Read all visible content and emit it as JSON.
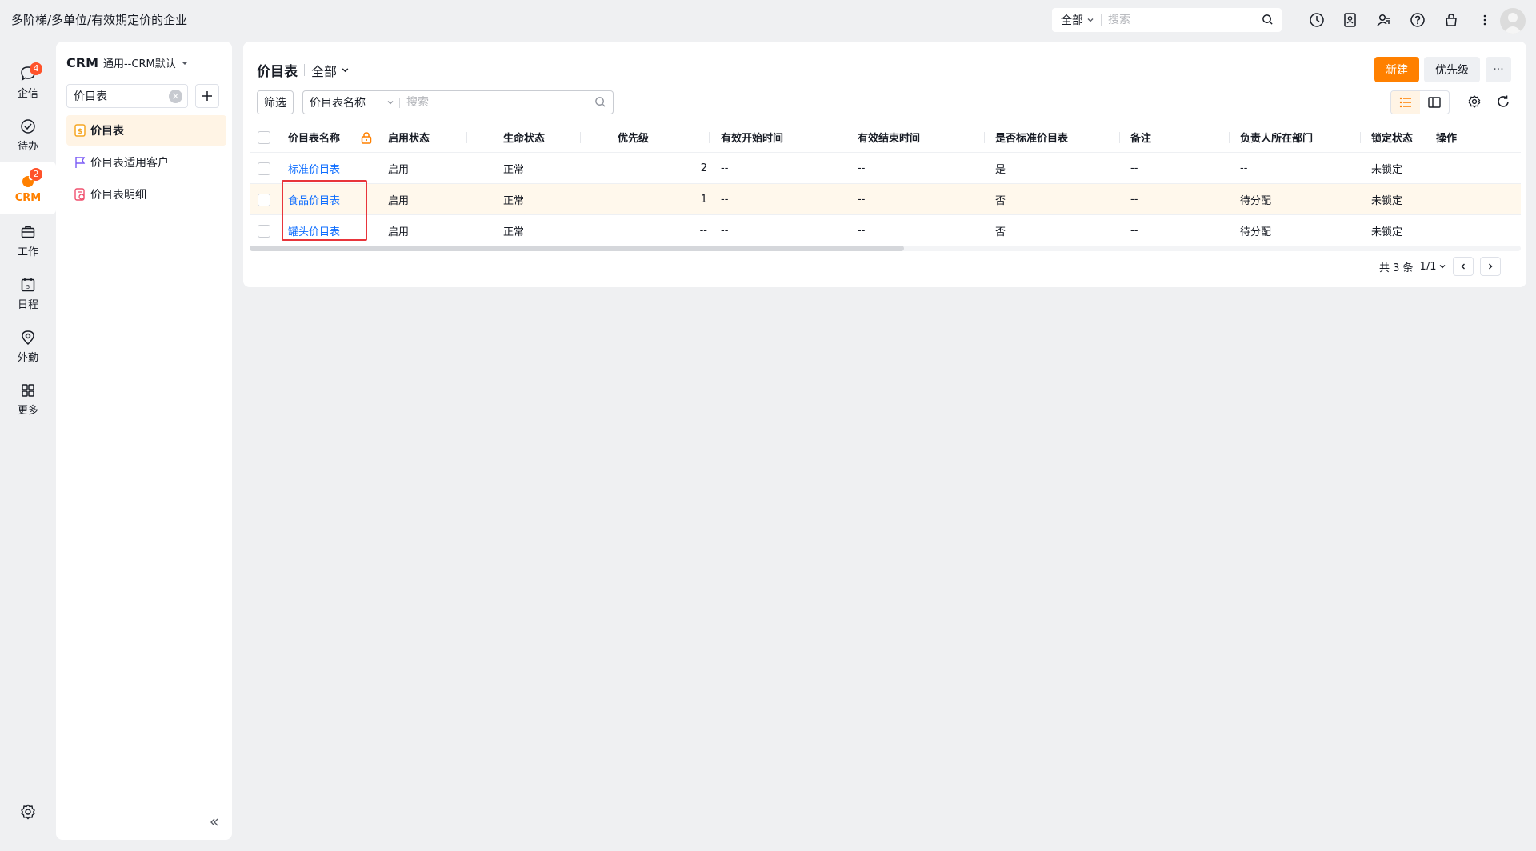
{
  "topbar": {
    "company": "多阶梯/多单位/有效期定价的企业",
    "search_scope": "全部",
    "search_placeholder": "搜索",
    "icons": [
      "history-icon",
      "contacts-book-icon",
      "user-list-icon",
      "help-icon",
      "bag-icon",
      "more-vertical-icon"
    ]
  },
  "rail": {
    "items": [
      {
        "label": "企信",
        "icon": "chat-bubble-icon",
        "badge": "4"
      },
      {
        "label": "待办",
        "icon": "check-circle-icon",
        "badge": ""
      },
      {
        "label": "CRM",
        "icon": "crm-icon",
        "badge": "2"
      },
      {
        "label": "工作",
        "icon": "briefcase-icon",
        "badge": ""
      },
      {
        "label": "日程",
        "icon": "calendar-icon",
        "badge": ""
      },
      {
        "label": "外勤",
        "icon": "location-pin-icon",
        "badge": ""
      },
      {
        "label": "更多",
        "icon": "grid-icon",
        "badge": ""
      }
    ]
  },
  "sidebar": {
    "app": "CRM",
    "view": "通用--CRM默认",
    "search_value": "价目表",
    "items": [
      {
        "label": "价目表",
        "icon": "price-list-icon"
      },
      {
        "label": "价目表适用客户",
        "icon": "flag-icon"
      },
      {
        "label": "价目表明细",
        "icon": "price-detail-icon"
      }
    ]
  },
  "main": {
    "title": "价目表",
    "scope": "全部",
    "new_label": "新建",
    "priority_label": "优先级",
    "more_label": "···",
    "filter_label": "筛选",
    "search_field": "价目表名称",
    "search_placeholder": "搜索"
  },
  "table": {
    "headers": [
      "价目表名称",
      "启用状态",
      "生命状态",
      "优先级",
      "有效开始时间",
      "有效结束时间",
      "是否标准价目表",
      "备注",
      "负责人所在部门",
      "锁定状态",
      "操作"
    ],
    "rows": [
      {
        "name": "标准价目表",
        "enable": "启用",
        "life": "正常",
        "priority": "2",
        "start": "--",
        "end": "--",
        "standard": "是",
        "remark": "--",
        "dept": "--",
        "lock": "未锁定"
      },
      {
        "name": "食品价目表",
        "enable": "启用",
        "life": "正常",
        "priority": "1",
        "start": "--",
        "end": "--",
        "standard": "否",
        "remark": "--",
        "dept": "待分配",
        "lock": "未锁定"
      },
      {
        "name": "罐头价目表",
        "enable": "启用",
        "life": "正常",
        "priority": "--",
        "start": "--",
        "end": "--",
        "standard": "否",
        "remark": "--",
        "dept": "待分配",
        "lock": "未锁定"
      }
    ]
  },
  "pager": {
    "total": "共 3 条",
    "page": "1/1"
  },
  "colors": {
    "accent": "#ff8000",
    "link": "#0c6cff",
    "badge": "#ff522a",
    "highlight": "#e8353b"
  }
}
